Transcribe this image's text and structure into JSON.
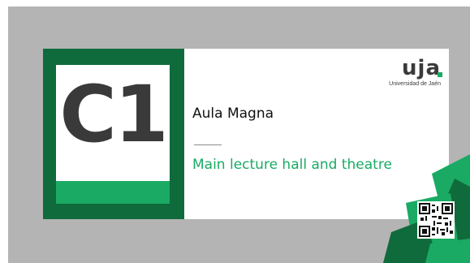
{
  "sign": {
    "code": "C1",
    "title": "Aula Magna",
    "subtitle": "Main lecture hall and theatre",
    "logo": {
      "mark": "uja",
      "caption": "Universidad de Jaén"
    }
  },
  "colors": {
    "dark_green": "#0f6b3b",
    "bright_green": "#1aaa64",
    "board_gray": "#b4b4b4",
    "text_dark": "#3a3a3a"
  },
  "icons": [
    "qr-code-icon",
    "university-logo"
  ]
}
